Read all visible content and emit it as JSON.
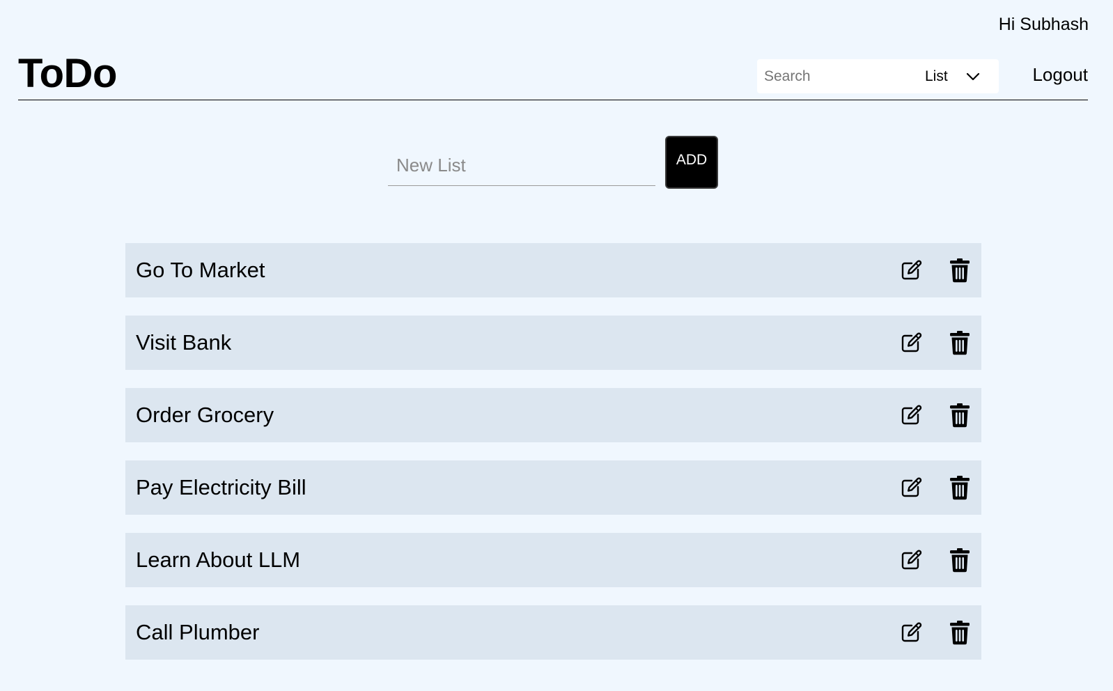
{
  "header": {
    "greeting": "Hi Subhash",
    "logo": "ToDo",
    "search": {
      "placeholder": "Search",
      "value": "",
      "filter_selected": "List"
    },
    "logout_label": "Logout"
  },
  "add_form": {
    "placeholder": "New List",
    "value": "",
    "add_label": "ADD"
  },
  "lists": [
    {
      "label": "Go To Market"
    },
    {
      "label": "Visit Bank"
    },
    {
      "label": "Order Grocery"
    },
    {
      "label": "Pay Electricity Bill"
    },
    {
      "label": "Learn About LLM"
    },
    {
      "label": "Call Plumber"
    }
  ],
  "icons": {
    "edit": "edit-icon",
    "delete": "trash-icon",
    "dropdown": "chevron-down-icon"
  },
  "colors": {
    "page_background": "#f0f7fe",
    "list_item_background": "#dce6f0",
    "add_button_background": "#000000"
  }
}
